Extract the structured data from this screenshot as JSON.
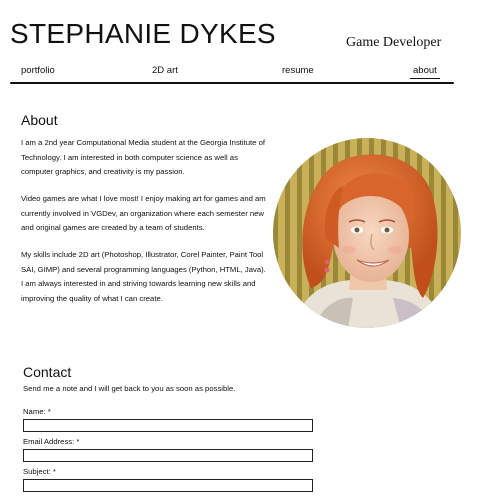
{
  "header": {
    "site_name": "STEPHANIE DYKES",
    "role": "Game Developer"
  },
  "nav": {
    "items": [
      {
        "label": "portfolio",
        "active": false
      },
      {
        "label": "2D art",
        "active": false
      },
      {
        "label": "resume",
        "active": false
      },
      {
        "label": "about",
        "active": true
      }
    ]
  },
  "about": {
    "heading": "About",
    "paragraphs": [
      "I am a 2nd year Computational Media student at the Georgia Institute of Technology. I am interested in both computer science as well as computer graphics, and creativity is my passion.",
      "Video games are what I love most! I enjoy making art for games and am currently involved in VGDev, an organization where each semester new and original games are created by a team of students.",
      "My skills include 2D art (Photoshop, Illustrator, Corel Painter, Paint Tool SAI, GIMP) and several programming languages (Python, HTML, Java). I am always interested in and striving towards learning new skills and improving the quality of what I can create."
    ]
  },
  "contact": {
    "heading": "Contact",
    "lead": "Send me a note and I will get back to you as soon as possible.",
    "fields": [
      {
        "label": "Name: *",
        "value": ""
      },
      {
        "label": "Email Address: *",
        "value": ""
      },
      {
        "label": "Subject: *",
        "value": ""
      }
    ]
  },
  "colors": {
    "text": "#111111",
    "background": "#ffffff",
    "hair": "#d9642a",
    "wall_stripes": "#b9a24a"
  },
  "icons": {
    "portrait": "profile-photo"
  }
}
